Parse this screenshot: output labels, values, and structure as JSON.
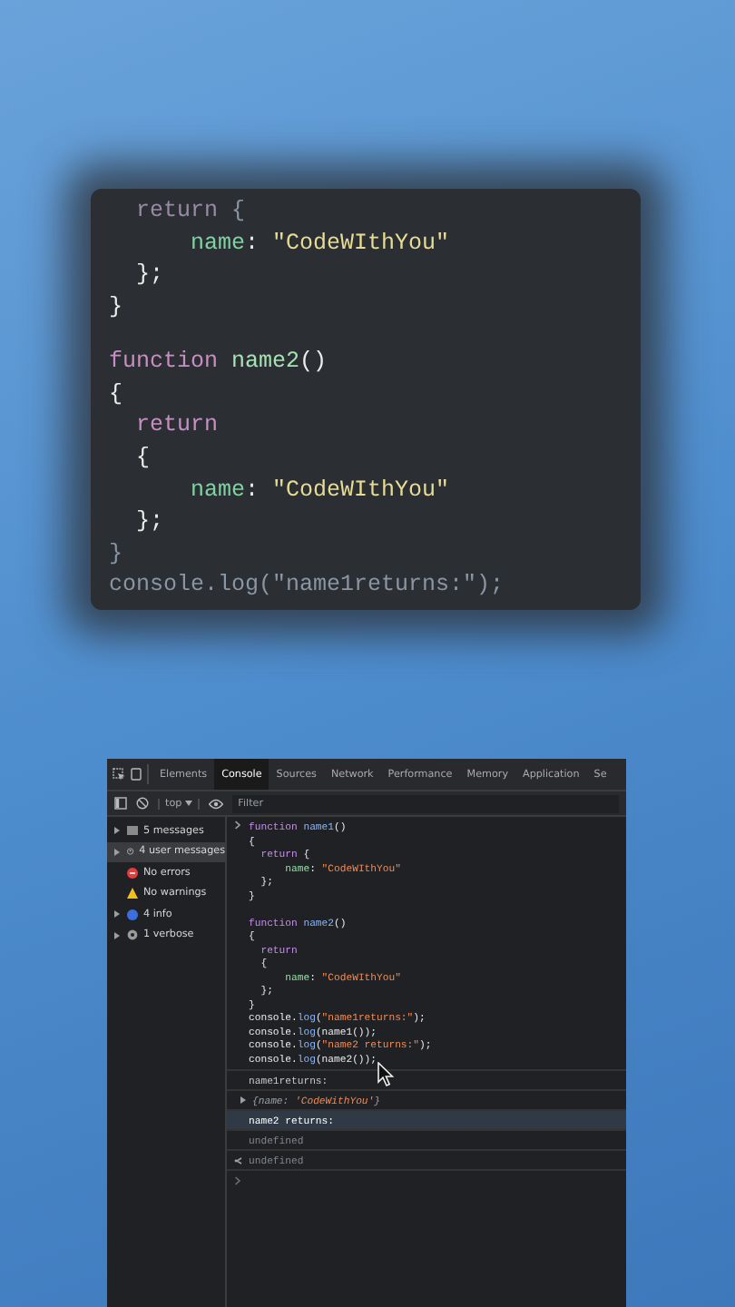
{
  "zoom_editor": {
    "lines": [
      {
        "faded": true,
        "tokens": [
          {
            "text": "  return ",
            "kind": "keyword"
          },
          {
            "text": "{",
            "kind": "punct"
          }
        ]
      },
      {
        "faded": false,
        "tokens": [
          {
            "text": "      name",
            "kind": "prop"
          },
          {
            "text": ": ",
            "kind": "punct"
          },
          {
            "text": "\"CodeWIthYou\"",
            "kind": "string"
          }
        ]
      },
      {
        "faded": false,
        "tokens": [
          {
            "text": "  };",
            "kind": "punct"
          }
        ]
      },
      {
        "faded": false,
        "tokens": [
          {
            "text": "}",
            "kind": "punct"
          }
        ]
      },
      {
        "kind": "blank"
      },
      {
        "faded": false,
        "tokens": [
          {
            "text": "function ",
            "kind": "keyword"
          },
          {
            "text": "name2",
            "kind": "fn"
          },
          {
            "text": "()",
            "kind": "punct"
          }
        ]
      },
      {
        "faded": false,
        "tokens": [
          {
            "text": "{",
            "kind": "punct"
          }
        ]
      },
      {
        "faded": false,
        "tokens": [
          {
            "text": "  return",
            "kind": "keyword"
          }
        ]
      },
      {
        "faded": false,
        "tokens": [
          {
            "text": "  {",
            "kind": "punct"
          }
        ]
      },
      {
        "faded": false,
        "tokens": [
          {
            "text": "      name",
            "kind": "prop"
          },
          {
            "text": ": ",
            "kind": "punct"
          },
          {
            "text": "\"CodeWIthYou\"",
            "kind": "string"
          }
        ]
      },
      {
        "faded": false,
        "tokens": [
          {
            "text": "  };",
            "kind": "punct"
          }
        ]
      },
      {
        "faded": true,
        "tokens": [
          {
            "text": "}",
            "kind": "punct"
          }
        ]
      },
      {
        "faded": true,
        "tokens": [
          {
            "text": "console.log(\"name1returns:\");",
            "kind": "punct"
          }
        ]
      }
    ]
  },
  "devtools": {
    "tabs": [
      {
        "label": "Elements",
        "selected": false
      },
      {
        "label": "Console",
        "selected": true
      },
      {
        "label": "Sources",
        "selected": false
      },
      {
        "label": "Network",
        "selected": false
      },
      {
        "label": "Performance",
        "selected": false
      },
      {
        "label": "Memory",
        "selected": false
      },
      {
        "label": "Application",
        "selected": false
      },
      {
        "label": "Se",
        "selected": false
      }
    ],
    "context": "top",
    "filter": {
      "placeholder": "Filter"
    },
    "sidebar": [
      {
        "label": "5 messages",
        "kind": "list",
        "expandable": true,
        "selected": false
      },
      {
        "label": "4 user messages",
        "kind": "user",
        "expandable": true,
        "selected": true
      },
      {
        "label": "No errors",
        "kind": "error",
        "expandable": false,
        "selected": false
      },
      {
        "label": "No warnings",
        "kind": "warning",
        "expandable": false,
        "selected": false
      },
      {
        "label": "4 info",
        "kind": "info",
        "expandable": true,
        "selected": false
      },
      {
        "label": "1 verbose",
        "kind": "verbose",
        "expandable": true,
        "selected": false
      }
    ],
    "console": [
      {
        "kind": "code",
        "hovered": false,
        "lines": [
          [
            {
              "text": "function ",
              "kind": "keyword"
            },
            {
              "text": "name1",
              "kind": "fn"
            },
            {
              "text": "()",
              "kind": "punct"
            }
          ],
          [
            {
              "text": "{",
              "kind": "punct"
            }
          ],
          [
            {
              "text": "  return ",
              "kind": "keyword"
            },
            {
              "text": "{",
              "kind": "punct"
            }
          ],
          [
            {
              "text": "      name",
              "kind": "prop"
            },
            {
              "text": ": ",
              "kind": "punct"
            },
            {
              "text": "\"CodeWIthYou\"",
              "kind": "string"
            }
          ],
          [
            {
              "text": "  };",
              "kind": "punct"
            }
          ],
          [
            {
              "text": "}",
              "kind": "punct"
            }
          ],
          {
            "kind": "blank"
          },
          [
            {
              "text": "function ",
              "kind": "keyword"
            },
            {
              "text": "name2",
              "kind": "fn"
            },
            {
              "text": "()",
              "kind": "punct"
            }
          ],
          [
            {
              "text": "{",
              "kind": "punct"
            }
          ],
          [
            {
              "text": "  return",
              "kind": "keyword"
            }
          ],
          [
            {
              "text": "  {",
              "kind": "punct"
            }
          ],
          [
            {
              "text": "      name",
              "kind": "prop"
            },
            {
              "text": ": ",
              "kind": "punct"
            },
            {
              "text": "\"CodeWIthYou\"",
              "kind": "string"
            }
          ],
          [
            {
              "text": "  };",
              "kind": "punct"
            }
          ],
          [
            {
              "text": "}",
              "kind": "punct"
            }
          ],
          [
            {
              "text": "console.",
              "kind": "punct"
            },
            {
              "text": "log",
              "kind": "fn"
            },
            {
              "text": "(",
              "kind": "punct"
            },
            {
              "text": "\"name1returns:\"",
              "kind": "string"
            },
            {
              "text": ");",
              "kind": "punct"
            }
          ],
          [
            {
              "text": "console.",
              "kind": "punct"
            },
            {
              "text": "log",
              "kind": "fn"
            },
            {
              "text": "(name1());",
              "kind": "punct"
            }
          ],
          [
            {
              "text": "console.",
              "kind": "punct"
            },
            {
              "text": "log",
              "kind": "fn"
            },
            {
              "text": "(",
              "kind": "punct"
            },
            {
              "text": "\"name2 returns:\"",
              "kind": "string"
            },
            {
              "text": ");",
              "kind": "punct"
            }
          ],
          [
            {
              "text": "console.",
              "kind": "punct"
            },
            {
              "text": "log",
              "kind": "fn"
            },
            {
              "text": "(name2());",
              "kind": "punct"
            }
          ]
        ]
      },
      {
        "kind": "log",
        "hovered": false,
        "text": "name1returns:"
      },
      {
        "kind": "object",
        "hovered": false,
        "tokens": [
          {
            "text": "{name: ",
            "kind": "key"
          },
          {
            "text": "'CodeWithYou'",
            "kind": "string"
          },
          {
            "text": "}",
            "kind": "key"
          }
        ]
      },
      {
        "kind": "log",
        "hovered": true,
        "text": "name2 returns:"
      },
      {
        "kind": "undefined",
        "hovered": false,
        "text": "undefined"
      },
      {
        "kind": "return",
        "hovered": false,
        "text": "undefined"
      },
      {
        "kind": "prompt",
        "hovered": false
      }
    ]
  }
}
